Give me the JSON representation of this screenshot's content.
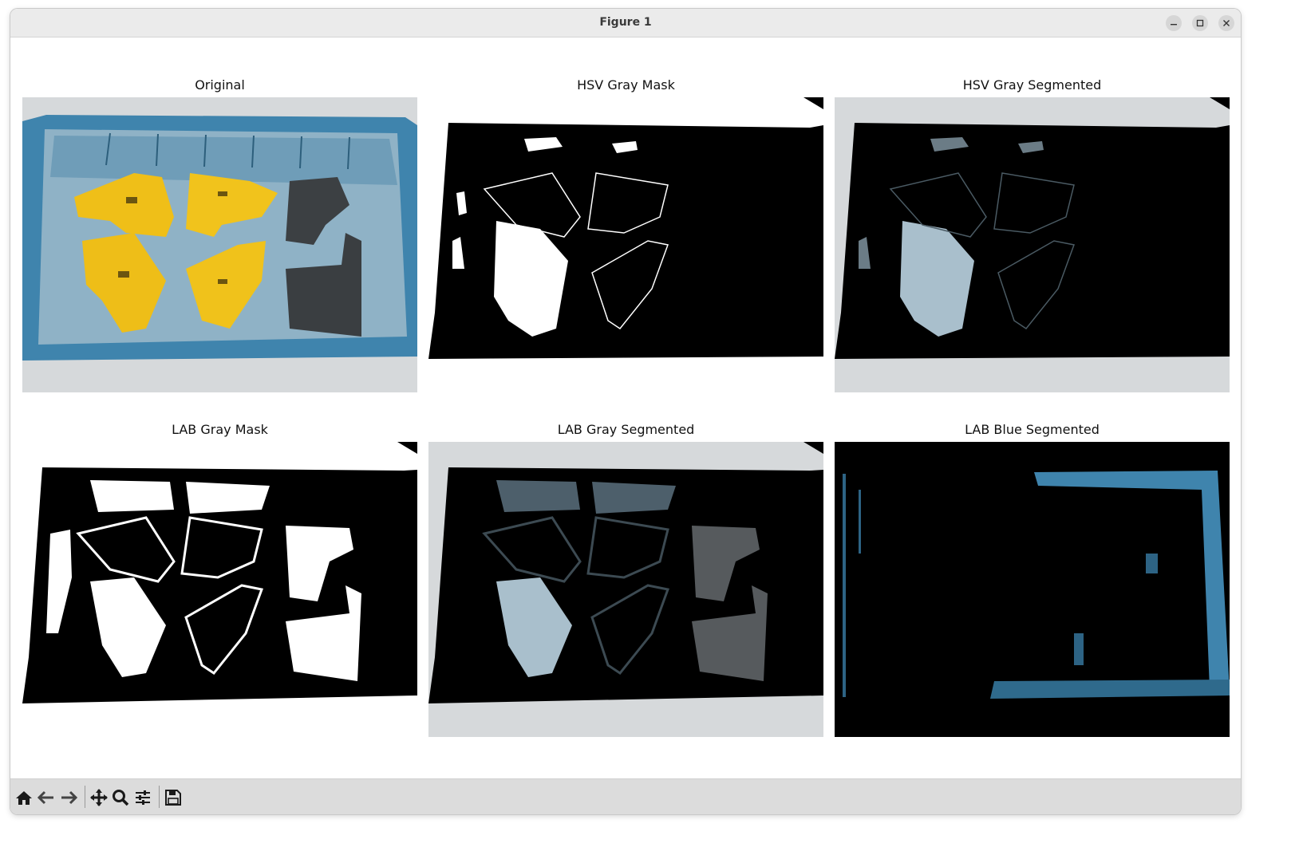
{
  "window": {
    "title": "Figure 1",
    "controls": [
      "minimize-icon",
      "maximize-icon",
      "close-icon"
    ]
  },
  "figure": {
    "panels": [
      {
        "title": "Original"
      },
      {
        "title": "HSV Gray Mask"
      },
      {
        "title": "HSV Gray Segmented"
      },
      {
        "title": "LAB Gray Mask"
      },
      {
        "title": "LAB Gray Segmented"
      },
      {
        "title": "LAB Blue Segmented"
      }
    ]
  },
  "toolbar": {
    "tools": [
      "home-icon",
      "back-icon",
      "forward-icon",
      "pan-icon",
      "zoom-icon",
      "configure-subplots-icon",
      "save-icon"
    ]
  },
  "colors": {
    "titlebar": "#ebebeb",
    "toolbar": "#dcdcdc",
    "bin_blue": "#4a8db3",
    "part_yellow": "#f0c21b",
    "part_dark": "#3b3f42",
    "table_gray": "#d6d9db"
  }
}
